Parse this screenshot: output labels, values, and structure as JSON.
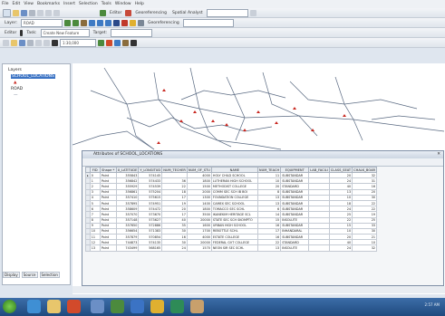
{
  "menu": [
    "File",
    "Edit",
    "View",
    "Bookmarks",
    "Insert",
    "Selection",
    "Tools",
    "Window",
    "Help"
  ],
  "toolbar1": {
    "editor_label": "Editor",
    "georef_label": "Georeferencing",
    "spatial_analyst_label": "Spatial Analyst"
  },
  "toolbar2": {
    "layer_label": "Layer:",
    "layer_value": "ROAD",
    "editor_label": "Editor",
    "task_label": "Create New Feature",
    "target_label": "Target:",
    "georef_label": "Georeferencing",
    "scale_value": "1:30,000"
  },
  "toc": {
    "root": "Layers",
    "layer1": "SCHOOL_LOCATIONS",
    "layer2": "ROAD",
    "tabs": [
      "Display",
      "Source",
      "Selection"
    ]
  },
  "attr": {
    "title": "Attributes of SCHOOL_LOCATIONS",
    "columns": [
      "FID",
      "Shape *",
      "X_LATITUDE",
      "Y_LONGITUD",
      "NUM_TECHER",
      "NUM_OF_STU",
      "NAME",
      "NUM_TEACH",
      "EQUIPMENT",
      "LAB_FACILI",
      "CLASS_SEAT",
      "CHALK_BOAR"
    ],
    "rows": [
      [
        "0",
        "Point",
        "355843",
        "574145",
        "",
        "4000",
        "HOLY CHILD SCHOOL",
        "11",
        "SUBSTANDAR",
        "",
        "20",
        "32"
      ],
      [
        "1",
        "Point",
        "356842",
        "574433",
        "36",
        "1800",
        "LUTHERAN HIGH SCHOOL",
        "10",
        "SUBSTANDAR",
        "",
        "24",
        "31"
      ],
      [
        "2",
        "Point",
        "355929",
        "574539",
        "22",
        "1500",
        "METHODIST COLLEGE",
        "20",
        "STANDARD",
        "",
        "40",
        "16"
      ],
      [
        "3",
        "Point",
        "356861",
        "575204",
        "18",
        "2000",
        "COMM SEC SCH IB BOI",
        "8",
        "SUBSTANDAR",
        "",
        "13",
        "20"
      ],
      [
        "4",
        "Point",
        "357410",
        "575615",
        "17",
        "1300",
        "FOUNDATION COLLEGE",
        "13",
        "SUBSTANDAR",
        "",
        "10",
        "30"
      ],
      [
        "5",
        "Point",
        "357895",
        "574951",
        "19",
        "1400",
        "CAMEX SEC SCHOOL",
        "13",
        "SUBSTANDAR",
        "",
        "18",
        "22"
      ],
      [
        "6",
        "Point",
        "358609",
        "574472",
        "20",
        "1800",
        "TOMACCO SEC SCHL",
        "6",
        "SUBSTANDAR",
        "",
        "24",
        "22"
      ],
      [
        "7",
        "Point",
        "357070",
        "573670",
        "17",
        "3500",
        "IKANEKIM HERITAGE SCL",
        "14",
        "SUBSTANDAR",
        "",
        "25",
        "19"
      ],
      [
        "8",
        "Point",
        "357148",
        "573627",
        "40",
        "20000",
        "STATE SEC SCH SKOMPTO",
        "15",
        "INSOLUTE",
        "",
        "22",
        "25"
      ],
      [
        "9",
        "Point",
        "357650",
        "572886",
        "35",
        "1600",
        "URBAN HIGH SCHOOL",
        "16",
        "SUBSTANDAR",
        "",
        "15",
        "33"
      ],
      [
        "10",
        "Point",
        "356654",
        "571383",
        "30",
        "1700",
        "REBOTTLE SCHL",
        "17",
        "INHANDARAL",
        "",
        "10",
        "30"
      ],
      [
        "11",
        "Point",
        "357879",
        "570854",
        "16",
        "4000",
        "ESTATE COLLEGE",
        "16",
        "SUBSTANDAR",
        "",
        "20",
        "21"
      ],
      [
        "12",
        "Point",
        "744873",
        "574135",
        "30",
        "20000",
        "FEDERAL GVT COLLEGE",
        "22",
        "STANDARD",
        "",
        "40",
        "10"
      ],
      [
        "13",
        "Point",
        "743499",
        "568165",
        "24",
        "1570",
        "NEON SIR SEC SCHL",
        "13",
        "INSOLUTE",
        "",
        "24",
        "32"
      ]
    ]
  },
  "taskbar": {
    "clock": "2:57 AM"
  },
  "colors": {
    "selection": "#3b73c4",
    "taskbar": "#1f4a7e",
    "road": "#5a6a82",
    "school": "#c8261e"
  }
}
